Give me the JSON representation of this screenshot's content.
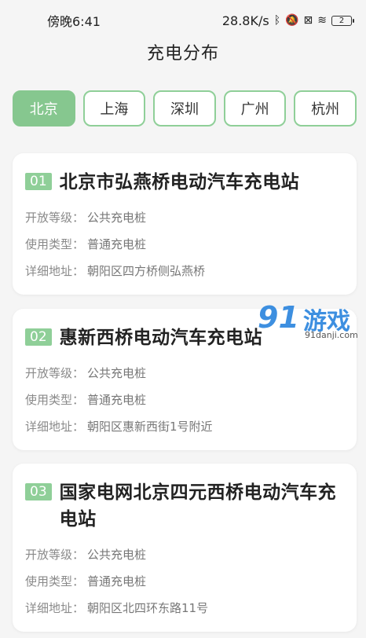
{
  "status": {
    "time": "傍晚6:41",
    "net_speed": "28.8K/s",
    "battery": "2"
  },
  "title": "充电分布",
  "tabs": [
    {
      "label": "北京",
      "active": true
    },
    {
      "label": "上海",
      "active": false
    },
    {
      "label": "深圳",
      "active": false
    },
    {
      "label": "广州",
      "active": false
    },
    {
      "label": "杭州",
      "active": false
    }
  ],
  "labels": {
    "level": "开放等级：",
    "type": "使用类型：",
    "address": "详细地址："
  },
  "stations": [
    {
      "num": "01",
      "name": "北京市弘燕桥电动汽车充电站",
      "level": "公共充电桩",
      "type": "普通充电桩",
      "address": "朝阳区四方桥侧弘燕桥"
    },
    {
      "num": "02",
      "name": "惠新西桥电动汽车充电站",
      "level": "公共充电桩",
      "type": "普通充电桩",
      "address": "朝阳区惠新西街1号附近"
    },
    {
      "num": "03",
      "name": "国家电网北京四元西桥电动汽车充电站",
      "level": "公共充电桩",
      "type": "普通充电桩",
      "address": "朝阳区北四环东路11号"
    }
  ],
  "watermark": {
    "logo": "91",
    "text": "游戏",
    "url": "91danji.com"
  }
}
